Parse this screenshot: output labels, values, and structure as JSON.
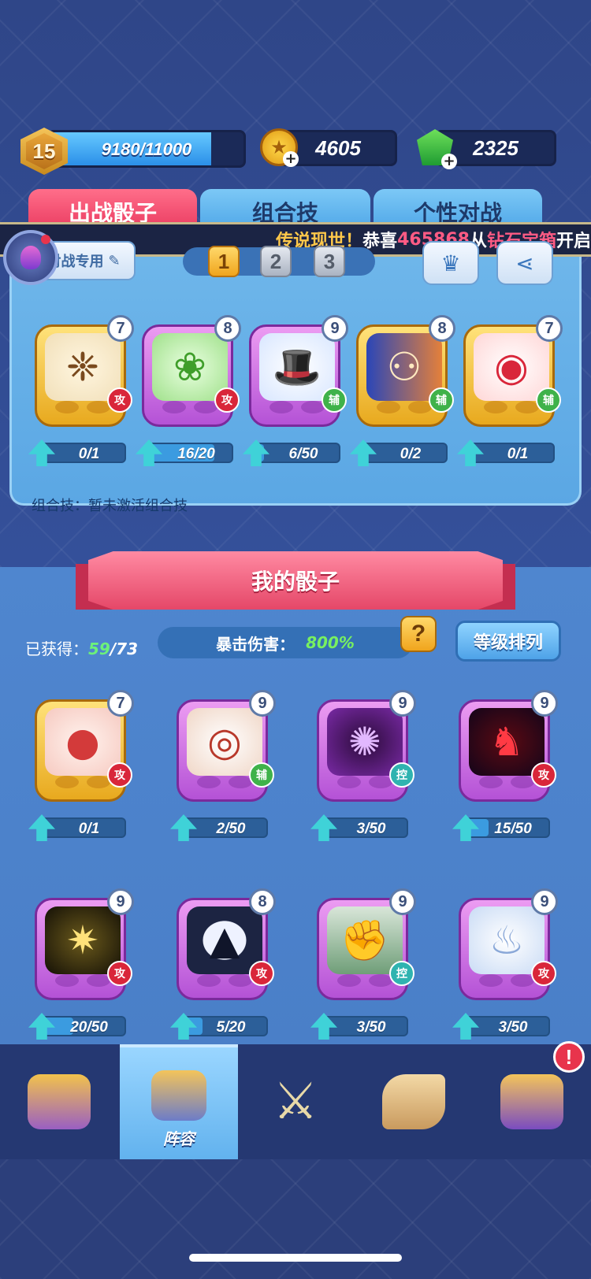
{
  "player": {
    "level": "15",
    "xp_text": "9180/11000",
    "xp_fraction": 0.835
  },
  "currencies": {
    "coins": "4605",
    "gems": "2325"
  },
  "tabs": [
    {
      "label": "出战骰子",
      "active": true
    },
    {
      "label": "组合技",
      "active": false
    },
    {
      "label": "个性对战",
      "active": false
    }
  ],
  "ticker": {
    "part1": "传说现世！",
    "part2": "恭喜",
    "part3": "465868",
    "part4": "从",
    "part5": "钻石宝箱",
    "part6": "开启"
  },
  "deck": {
    "battle_use_label": "对战专用",
    "pages": [
      "1",
      "2",
      "3"
    ],
    "active_page": "1",
    "dice": [
      {
        "level": "7",
        "tag": "攻",
        "tag_type": "atk",
        "rarity": "gold",
        "progress_text": "0/1",
        "progress": 0.0,
        "icon": "spiky-hair-icon"
      },
      {
        "level": "8",
        "tag": "攻",
        "tag_type": "atk",
        "rarity": "purple",
        "progress_text": "16/20",
        "progress": 0.8,
        "icon": "thorn-wreath-icon"
      },
      {
        "level": "9",
        "tag": "辅",
        "tag_type": "sup",
        "rarity": "purple",
        "progress_text": "6/50",
        "progress": 0.12,
        "icon": "magic-hat-icon"
      },
      {
        "level": "8",
        "tag": "辅",
        "tag_type": "sup",
        "rarity": "gold",
        "progress_text": "0/2",
        "progress": 0.0,
        "icon": "twin-silhouette-icon"
      },
      {
        "level": "7",
        "tag": "辅",
        "tag_type": "sup",
        "rarity": "gold",
        "progress_text": "0/1",
        "progress": 0.0,
        "icon": "red-hat-icon"
      }
    ],
    "combo_text": "组合技：暂未激活组合技"
  },
  "my_dice": {
    "title": "我的骰子",
    "obtained_label": "已获得：",
    "obtained_count": "59",
    "obtained_total": "/73",
    "crit_label": "暴击伤害：",
    "crit_value": "800%",
    "help_label": "?",
    "sort_label": "等级排列",
    "dice": [
      {
        "level": "7",
        "tag": "攻",
        "tag_type": "atk",
        "rarity": "gold",
        "progress_text": "0/1",
        "progress": 0.0,
        "icon": "meat-icon"
      },
      {
        "level": "9",
        "tag": "辅",
        "tag_type": "sup",
        "rarity": "purple",
        "progress_text": "2/50",
        "progress": 0.04,
        "icon": "drum-icon"
      },
      {
        "level": "9",
        "tag": "控",
        "tag_type": "ctl",
        "rarity": "purple",
        "progress_text": "3/50",
        "progress": 0.06,
        "icon": "sharingan-icon"
      },
      {
        "level": "9",
        "tag": "攻",
        "tag_type": "atk",
        "rarity": "purple",
        "progress_text": "15/50",
        "progress": 0.3,
        "icon": "demon-mask-icon"
      },
      {
        "level": "9",
        "tag": "攻",
        "tag_type": "atk",
        "rarity": "purple",
        "progress_text": "20/50",
        "progress": 0.4,
        "icon": "rune-circle-icon"
      },
      {
        "level": "8",
        "tag": "攻",
        "tag_type": "atk",
        "rarity": "purple",
        "progress_text": "5/20",
        "progress": 0.25,
        "icon": "howling-wolf-icon"
      },
      {
        "level": "9",
        "tag": "控",
        "tag_type": "ctl",
        "rarity": "purple",
        "progress_text": "3/50",
        "progress": 0.06,
        "icon": "bandaged-fist-icon"
      },
      {
        "level": "9",
        "tag": "攻",
        "tag_type": "atk",
        "rarity": "purple",
        "progress_text": "3/50",
        "progress": 0.06,
        "icon": "white-flame-icon"
      }
    ]
  },
  "nav": {
    "items": [
      {
        "icon": "treasure-chest-icon"
      },
      {
        "icon": "cannon-drum-icon",
        "label": "阵容",
        "active": true
      },
      {
        "icon": "crossed-swords-icon"
      },
      {
        "icon": "scroll-quill-icon"
      },
      {
        "icon": "spellbook-icon"
      }
    ],
    "alert": "!"
  }
}
